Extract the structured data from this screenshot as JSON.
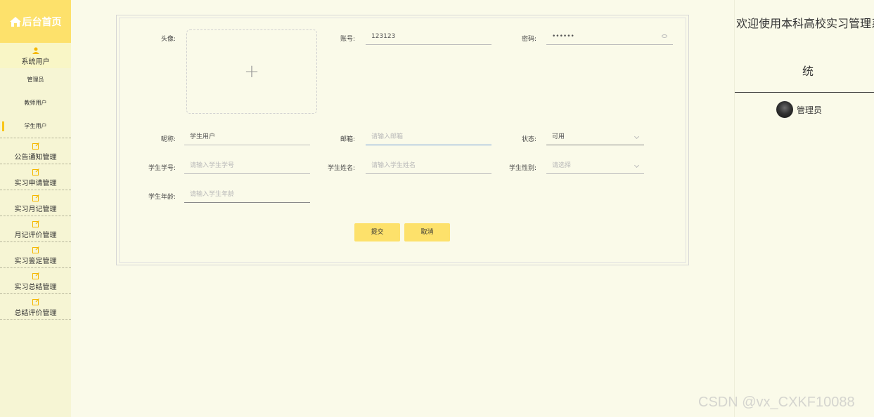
{
  "sidebar": {
    "logo_title": "后台首页",
    "groups": [
      {
        "label": "系统用户",
        "sub": [
          "管理员",
          "教师用户",
          "学生用户"
        ]
      },
      {
        "label": "公告通知管理"
      },
      {
        "label": "实习申请管理"
      },
      {
        "label": "实习月记管理"
      },
      {
        "label": "月记评价管理"
      },
      {
        "label": "实习鉴定管理"
      },
      {
        "label": "实习总结管理"
      },
      {
        "label": "总结评价管理"
      }
    ],
    "selected_sub": "学生用户"
  },
  "form": {
    "avatar_label": "头像:",
    "account_label": "账号:",
    "account_value": "123123",
    "password_label": "密码:",
    "password_value": "••••••",
    "nickname_label": "昵称:",
    "nickname_value": "学生用户",
    "email_label": "邮箱:",
    "email_placeholder": "请输入邮箱",
    "status_label": "状态:",
    "status_value": "可用",
    "student_no_label": "学生学号:",
    "student_no_placeholder": "请输入学生学号",
    "student_name_label": "学生姓名:",
    "student_name_placeholder": "请输入学生姓名",
    "student_gender_label": "学生性别:",
    "student_gender_placeholder": "请选择",
    "student_age_label": "学生年龄:",
    "student_age_placeholder": "请输入学生年龄",
    "upload_plus": "+",
    "submit_label": "提交",
    "cancel_label": "取消"
  },
  "right_panel": {
    "welcome_line1": "欢迎使用本科高校实习管理系",
    "welcome_line2": "统",
    "user_role": "管理员"
  },
  "watermark": "CSDN @vx_CXKF10088",
  "colors": {
    "accent": "#fde16b",
    "background": "#fafae9",
    "sidebar": "#f6f5d4",
    "selected_marker": "#f9c518"
  }
}
